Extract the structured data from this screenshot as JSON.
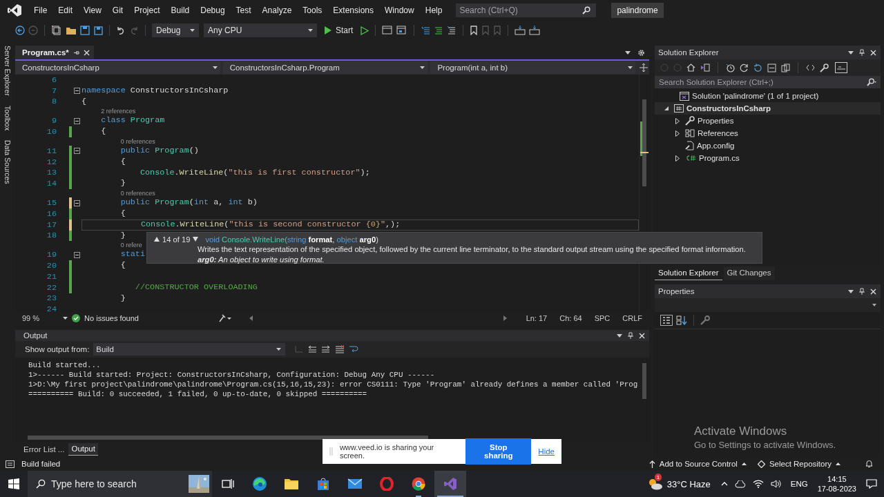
{
  "menu": {
    "items": [
      "File",
      "Edit",
      "View",
      "Git",
      "Project",
      "Build",
      "Debug",
      "Test",
      "Analyze",
      "Tools",
      "Extensions",
      "Window",
      "Help"
    ],
    "search": {
      "placeholder": "Search (Ctrl+Q)"
    },
    "solution_name": "palindrome"
  },
  "toolbar": {
    "configuration": "Debug",
    "platform": "Any CPU",
    "start": "Start"
  },
  "side_tabs": [
    "Server Explorer",
    "Toolbox",
    "Data Sources"
  ],
  "editor": {
    "tab": {
      "title": "Program.cs*",
      "selected": true
    },
    "nav": [
      "ConstructorsInCsharp",
      "ConstructorsInCsharp.Program",
      "Program(int a, int b)"
    ],
    "lines": [
      {
        "n": "6",
        "saved_change": false,
        "unsaved_change": false,
        "fold": false,
        "current": false
      },
      {
        "n": "7",
        "saved_change": false,
        "unsaved_change": false,
        "fold": true,
        "current": false,
        "tokens": [
          {
            "t": "namespace",
            "kind": "kw"
          },
          {
            "t": " ConstructorsInCsharp",
            "kind": "plain"
          }
        ]
      },
      {
        "n": "8",
        "saved_change": false,
        "unsaved_change": false,
        "fold": false,
        "current": false,
        "tokens": [
          {
            "t": "{",
            "kind": "plain"
          }
        ]
      },
      {
        "n": "9",
        "saved_change": false,
        "unsaved_change": false,
        "fold": true,
        "current": false,
        "lens": "2 references",
        "tokens": [
          {
            "t": "    class",
            "kind": "kw"
          },
          {
            "t": " Program",
            "kind": "type"
          }
        ]
      },
      {
        "n": "10",
        "saved_change": true,
        "unsaved_change": false,
        "fold": false,
        "current": false,
        "tokens": [
          {
            "t": "    {",
            "kind": "plain"
          }
        ]
      },
      {
        "n": "11",
        "saved_change": true,
        "unsaved_change": false,
        "fold": true,
        "current": false,
        "lens": "0 references",
        "tokens": [
          {
            "t": "        public",
            "kind": "kw"
          },
          {
            "t": " Program",
            "kind": "type"
          },
          {
            "t": "()",
            "kind": "plain"
          }
        ]
      },
      {
        "n": "12",
        "saved_change": true,
        "unsaved_change": false,
        "fold": false,
        "current": false,
        "tokens": [
          {
            "t": "        {",
            "kind": "plain"
          }
        ]
      },
      {
        "n": "13",
        "saved_change": true,
        "unsaved_change": false,
        "fold": false,
        "current": false,
        "tokens": [
          {
            "t": "            Console",
            "kind": "type"
          },
          {
            "t": ".",
            "kind": "plain"
          },
          {
            "t": "WriteLine",
            "kind": "method"
          },
          {
            "t": "(",
            "kind": "plain"
          },
          {
            "t": "\"this is first constructor\"",
            "kind": "str"
          },
          {
            "t": ");",
            "kind": "plain"
          }
        ]
      },
      {
        "n": "14",
        "saved_change": true,
        "unsaved_change": false,
        "fold": false,
        "current": false,
        "tokens": [
          {
            "t": "        }",
            "kind": "plain"
          }
        ]
      },
      {
        "n": "15",
        "saved_change": false,
        "unsaved_change": true,
        "fold": true,
        "current": false,
        "lens": "0 references",
        "tokens": [
          {
            "t": "        public",
            "kind": "kw"
          },
          {
            "t": " Program",
            "kind": "type"
          },
          {
            "t": "(",
            "kind": "plain"
          },
          {
            "t": "int",
            "kind": "kw"
          },
          {
            "t": " a, ",
            "kind": "plain"
          },
          {
            "t": "int",
            "kind": "kw"
          },
          {
            "t": " b)",
            "kind": "plain"
          }
        ]
      },
      {
        "n": "16",
        "saved_change": true,
        "unsaved_change": false,
        "fold": false,
        "current": false,
        "tokens": [
          {
            "t": "        {",
            "kind": "plain"
          }
        ]
      },
      {
        "n": "17",
        "saved_change": false,
        "unsaved_change": true,
        "fold": false,
        "current": true,
        "tokens": [
          {
            "t": "            Console",
            "kind": "type"
          },
          {
            "t": ".",
            "kind": "plain"
          },
          {
            "t": "WriteLine",
            "kind": "method"
          },
          {
            "t": "(",
            "kind": "plain"
          },
          {
            "t": "\"this is second constructor ",
            "kind": "str"
          },
          {
            "t": "{0}",
            "kind": "format"
          },
          {
            "t": "\"",
            "kind": "str"
          },
          {
            "t": ",);",
            "kind": "plain"
          }
        ]
      },
      {
        "n": "18",
        "saved_change": true,
        "unsaved_change": false,
        "fold": false,
        "current": false,
        "tokens": [
          {
            "t": "        }",
            "kind": "plain"
          }
        ]
      },
      {
        "n": "19",
        "saved_change": false,
        "unsaved_change": false,
        "fold": true,
        "current": false,
        "lens": "0 refere",
        "tokens": [
          {
            "t": "        stati",
            "kind": "kw"
          }
        ]
      },
      {
        "n": "20",
        "saved_change": true,
        "unsaved_change": false,
        "fold": false,
        "current": false,
        "tokens": [
          {
            "t": "        {",
            "kind": "plain"
          }
        ]
      },
      {
        "n": "21",
        "saved_change": true,
        "unsaved_change": false,
        "fold": false,
        "current": false
      },
      {
        "n": "22",
        "saved_change": true,
        "unsaved_change": false,
        "fold": false,
        "current": false,
        "tokens": [
          {
            "t": "           //CONSTRUCTOR OVERLOADING",
            "kind": "comment"
          }
        ]
      },
      {
        "n": "23",
        "saved_change": false,
        "unsaved_change": false,
        "fold": false,
        "current": false,
        "tokens": [
          {
            "t": "        }",
            "kind": "plain"
          }
        ]
      },
      {
        "n": "24",
        "saved_change": false,
        "unsaved_change": false,
        "fold": false,
        "current": false
      }
    ],
    "tooltip": {
      "counter": "14 of 19",
      "signature": [
        {
          "t": "void ",
          "kind": "kw"
        },
        {
          "t": "Console.WriteLine(",
          "kind": "type"
        },
        {
          "t": "string ",
          "kind": "kw"
        },
        {
          "t": "format",
          "kind": "param"
        },
        {
          "t": ", ",
          "kind": "plain"
        },
        {
          "t": "object ",
          "kind": "kw"
        },
        {
          "t": "arg0",
          "kind": "param"
        },
        {
          "t": ")",
          "kind": "plain"
        }
      ],
      "description": "Writes the text representation of the specified object, followed by the current line terminator, to the standard output stream using the specified format information.",
      "param": "**arg0:** An object to write using format."
    },
    "status": {
      "zoom": "99 %",
      "issues": "No issues found",
      "line": "Ln: 17",
      "col": "Ch: 64",
      "spacing": "SPC",
      "eol": "CRLF"
    }
  },
  "output": {
    "title": "Output",
    "source_label": "Show output from:",
    "source": "Build",
    "lines": [
      "Build started...",
      "1>------ Build started: Project: ConstructorsInCsharp, Configuration: Debug Any CPU ------",
      "1>D:\\My first project\\palindrome\\palindrome\\Program.cs(15,16,15,23): error CS0111: Type 'Program' already defines a member called 'Prog",
      "========== Build: 0 succeeded, 1 failed, 0 up-to-date, 0 skipped =========="
    ],
    "tabs": [
      {
        "label": "Error List ...",
        "selected": false
      },
      {
        "label": "Output",
        "selected": true
      }
    ]
  },
  "solution_explorer": {
    "title": "Solution Explorer",
    "search": {
      "placeholder": "Search Solution Explorer (Ctrl+;)"
    },
    "tree": [
      {
        "label": "Solution 'palindrome' (1 of 1 project)",
        "kind": "solution",
        "expandable": false,
        "selected": false,
        "children": [
          {
            "label": "ConstructorsInCsharp",
            "kind": "project",
            "expandable": true,
            "expanded": true,
            "selected": true,
            "children": [
              {
                "label": "Properties",
                "kind": "properties",
                "expandable": true,
                "expanded": false,
                "selected": false
              },
              {
                "label": "References",
                "kind": "references",
                "expandable": true,
                "expanded": false,
                "selected": false
              },
              {
                "label": "App.config",
                "kind": "config",
                "expandable": false,
                "selected": false
              },
              {
                "label": "Program.cs",
                "kind": "source",
                "expandable": true,
                "expanded": false,
                "selected": false
              }
            ]
          }
        ]
      }
    ]
  },
  "panel_tabs": [
    {
      "label": "Solution Explorer",
      "selected": true
    },
    {
      "label": "Git Changes",
      "selected": false
    }
  ],
  "properties": {
    "title": "Properties"
  },
  "activation": {
    "title": "Activate Windows",
    "hint": "Go to Settings to activate Windows."
  },
  "status_bar": {
    "message": "Build failed",
    "source_control": "Add to Source Control",
    "repository": "Select Repository"
  },
  "share_bar": {
    "message": "www.veed.io is sharing your screen.",
    "stop": "Stop sharing",
    "hide": "Hide"
  },
  "taskbar": {
    "search": {
      "placeholder": "Type here to search"
    },
    "apps": [
      {
        "kind": "task-view",
        "running": false,
        "selected": false
      },
      {
        "kind": "edge",
        "running": false,
        "selected": false
      },
      {
        "kind": "explorer",
        "running": false,
        "selected": false
      },
      {
        "kind": "store",
        "running": false,
        "selected": false
      },
      {
        "kind": "mail",
        "running": false,
        "selected": false
      },
      {
        "kind": "opera",
        "running": false,
        "selected": false
      },
      {
        "kind": "chrome",
        "running": true,
        "selected": false
      },
      {
        "kind": "visual-studio",
        "running": true,
        "selected": true
      }
    ],
    "weather": "33°C Haze",
    "weather_badge": "1",
    "language": "ENG",
    "time": "14:15",
    "date": "17-08-2023"
  }
}
